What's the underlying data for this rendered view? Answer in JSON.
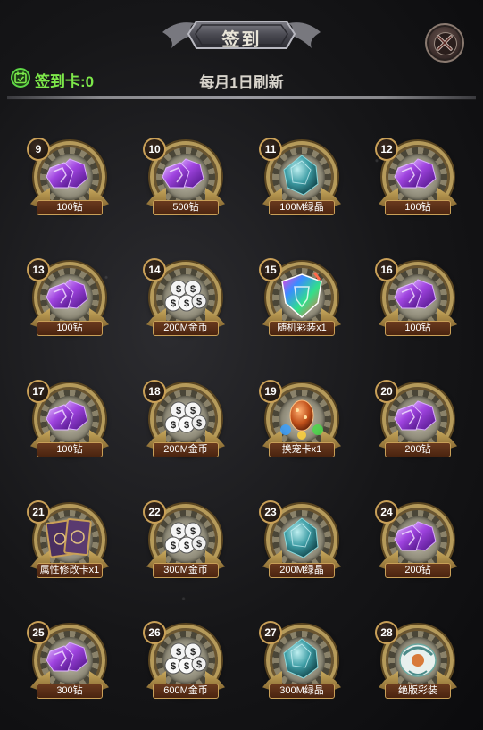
{
  "header": {
    "title": "签到",
    "card_label": "签到卡:0",
    "refresh_text": "每月1日刷新"
  },
  "colors": {
    "card_label": "#7de84a",
    "medal_gold": "#b59a5a",
    "banner_bg": "#5a2e16"
  },
  "rewards": [
    {
      "day": "9",
      "label": "100钻",
      "icon": "purple-gem-icon"
    },
    {
      "day": "10",
      "label": "500钻",
      "icon": "purple-gem-icon"
    },
    {
      "day": "11",
      "label": "100M绿晶",
      "icon": "green-crystal-icon"
    },
    {
      "day": "12",
      "label": "100钻",
      "icon": "purple-gem-icon"
    },
    {
      "day": "13",
      "label": "100钻",
      "icon": "purple-gem-icon"
    },
    {
      "day": "14",
      "label": "200M金币",
      "icon": "coin-bags-icon"
    },
    {
      "day": "15",
      "label": "随机彩装x1",
      "icon": "rainbow-shield-icon"
    },
    {
      "day": "16",
      "label": "100钻",
      "icon": "purple-gem-icon"
    },
    {
      "day": "17",
      "label": "100钻",
      "icon": "purple-gem-icon"
    },
    {
      "day": "18",
      "label": "200M金币",
      "icon": "coin-bags-icon"
    },
    {
      "day": "19",
      "label": "换宠卡x1",
      "icon": "pet-egg-icon"
    },
    {
      "day": "20",
      "label": "200钻",
      "icon": "purple-gem-icon"
    },
    {
      "day": "21",
      "label": "属性修改卡x1",
      "icon": "attribute-cards-icon"
    },
    {
      "day": "22",
      "label": "300M金币",
      "icon": "coin-bags-icon"
    },
    {
      "day": "23",
      "label": "200M绿晶",
      "icon": "green-crystal-icon"
    },
    {
      "day": "24",
      "label": "200钻",
      "icon": "purple-gem-icon"
    },
    {
      "day": "25",
      "label": "300钻",
      "icon": "purple-gem-icon"
    },
    {
      "day": "26",
      "label": "600M金币",
      "icon": "coin-bags-icon"
    },
    {
      "day": "27",
      "label": "300M绿晶",
      "icon": "green-crystal-icon"
    },
    {
      "day": "28",
      "label": "绝版彩装",
      "icon": "rare-costume-icon"
    }
  ]
}
